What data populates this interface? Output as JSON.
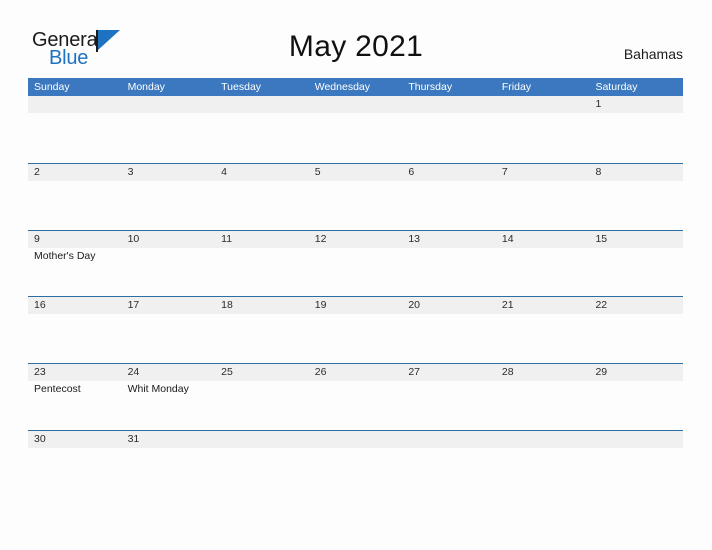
{
  "brand": {
    "name_part1": "General",
    "name_part2": "Blue",
    "flag_icon": "flag-icon"
  },
  "header": {
    "title": "May 2021",
    "region": "Bahamas"
  },
  "colors": {
    "header_blue": "#3b78bf",
    "rule_blue": "#2e6da4",
    "band_gray": "#f0f0f0",
    "brand_blue": "#1d72c2",
    "page_background": "#fdfdfd"
  },
  "calendar": {
    "month": "May",
    "year": "2021",
    "weekday_headers": [
      "Sunday",
      "Monday",
      "Tuesday",
      "Wednesday",
      "Thursday",
      "Friday",
      "Saturday"
    ],
    "weeks": [
      {
        "days": [
          {
            "number": "",
            "events": []
          },
          {
            "number": "",
            "events": []
          },
          {
            "number": "",
            "events": []
          },
          {
            "number": "",
            "events": []
          },
          {
            "number": "",
            "events": []
          },
          {
            "number": "",
            "events": []
          },
          {
            "number": "1",
            "events": []
          }
        ]
      },
      {
        "days": [
          {
            "number": "2",
            "events": []
          },
          {
            "number": "3",
            "events": []
          },
          {
            "number": "4",
            "events": []
          },
          {
            "number": "5",
            "events": []
          },
          {
            "number": "6",
            "events": []
          },
          {
            "number": "7",
            "events": []
          },
          {
            "number": "8",
            "events": []
          }
        ]
      },
      {
        "days": [
          {
            "number": "9",
            "events": [
              "Mother's Day"
            ]
          },
          {
            "number": "10",
            "events": []
          },
          {
            "number": "11",
            "events": []
          },
          {
            "number": "12",
            "events": []
          },
          {
            "number": "13",
            "events": []
          },
          {
            "number": "14",
            "events": []
          },
          {
            "number": "15",
            "events": []
          }
        ]
      },
      {
        "days": [
          {
            "number": "16",
            "events": []
          },
          {
            "number": "17",
            "events": []
          },
          {
            "number": "18",
            "events": []
          },
          {
            "number": "19",
            "events": []
          },
          {
            "number": "20",
            "events": []
          },
          {
            "number": "21",
            "events": []
          },
          {
            "number": "22",
            "events": []
          }
        ]
      },
      {
        "days": [
          {
            "number": "23",
            "events": [
              "Pentecost"
            ]
          },
          {
            "number": "24",
            "events": [
              "Whit Monday"
            ]
          },
          {
            "number": "25",
            "events": []
          },
          {
            "number": "26",
            "events": []
          },
          {
            "number": "27",
            "events": []
          },
          {
            "number": "28",
            "events": []
          },
          {
            "number": "29",
            "events": []
          }
        ]
      },
      {
        "days": [
          {
            "number": "30",
            "events": []
          },
          {
            "number": "31",
            "events": []
          },
          {
            "number": "",
            "events": []
          },
          {
            "number": "",
            "events": []
          },
          {
            "number": "",
            "events": []
          },
          {
            "number": "",
            "events": []
          },
          {
            "number": "",
            "events": []
          }
        ]
      }
    ]
  }
}
